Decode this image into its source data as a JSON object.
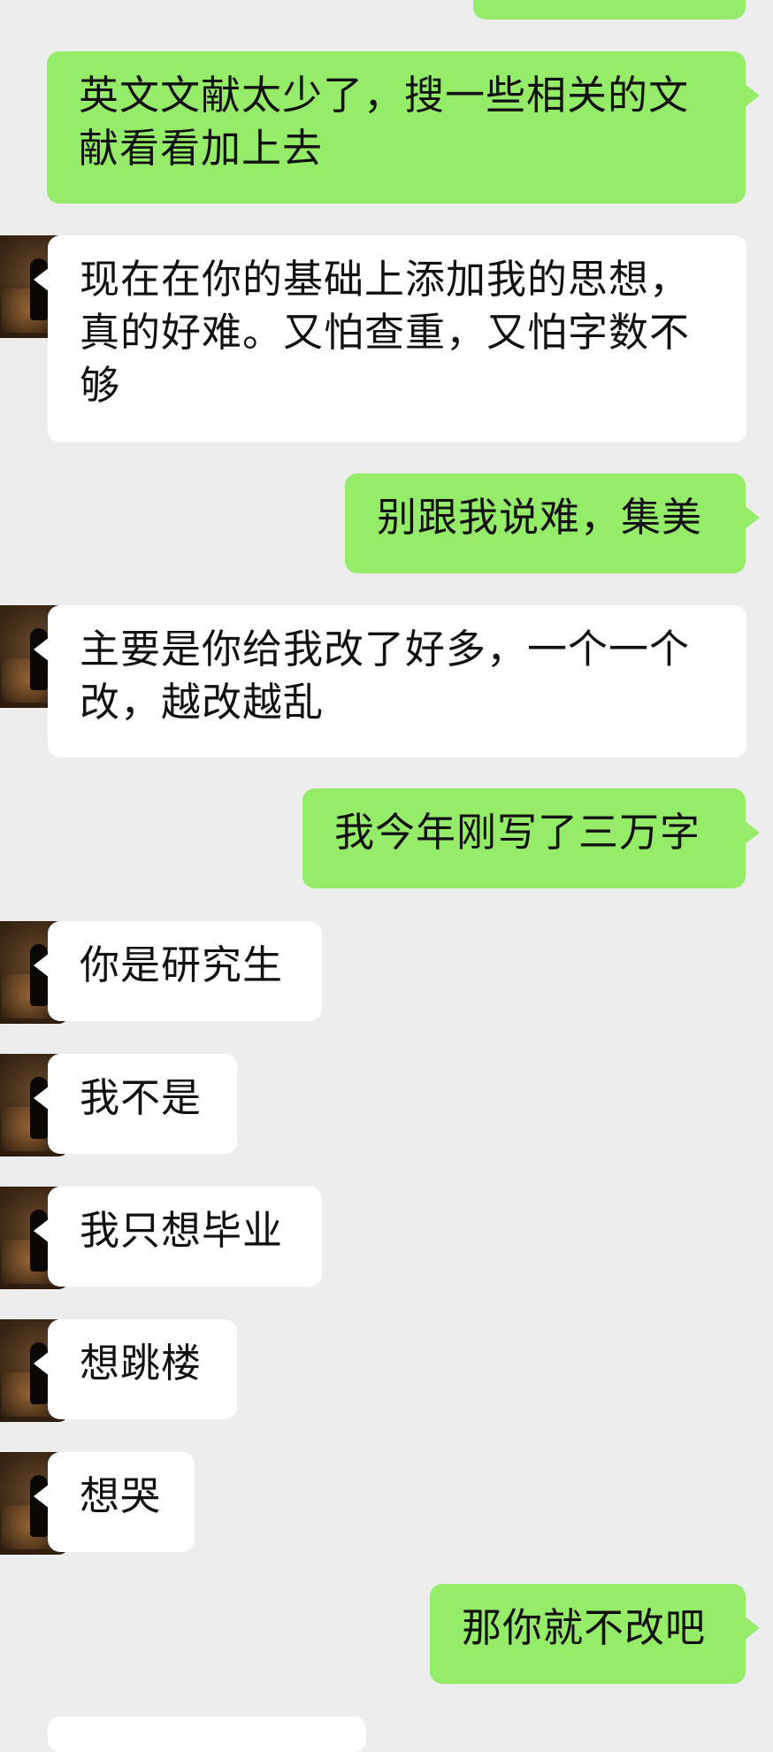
{
  "chat": {
    "messages": [
      {
        "side": "sent",
        "text": "英文文献太少了，搜一些相关的文献看看加上去"
      },
      {
        "side": "recv",
        "text": "现在在你的基础上添加我的思想，真的好难。又怕查重，又怕字数不够"
      },
      {
        "side": "sent",
        "text": "别跟我说难，集美"
      },
      {
        "side": "recv",
        "text": "主要是你给我改了好多，一个一个改，越改越乱"
      },
      {
        "side": "sent",
        "text": "我今年刚写了三万字"
      },
      {
        "side": "recv",
        "text": "你是研究生"
      },
      {
        "side": "recv",
        "text": "我不是"
      },
      {
        "side": "recv",
        "text": "我只想毕业"
      },
      {
        "side": "recv",
        "text": "想跳楼"
      },
      {
        "side": "recv",
        "text": "想哭"
      },
      {
        "side": "sent",
        "text": "那你就不改吧"
      }
    ]
  }
}
